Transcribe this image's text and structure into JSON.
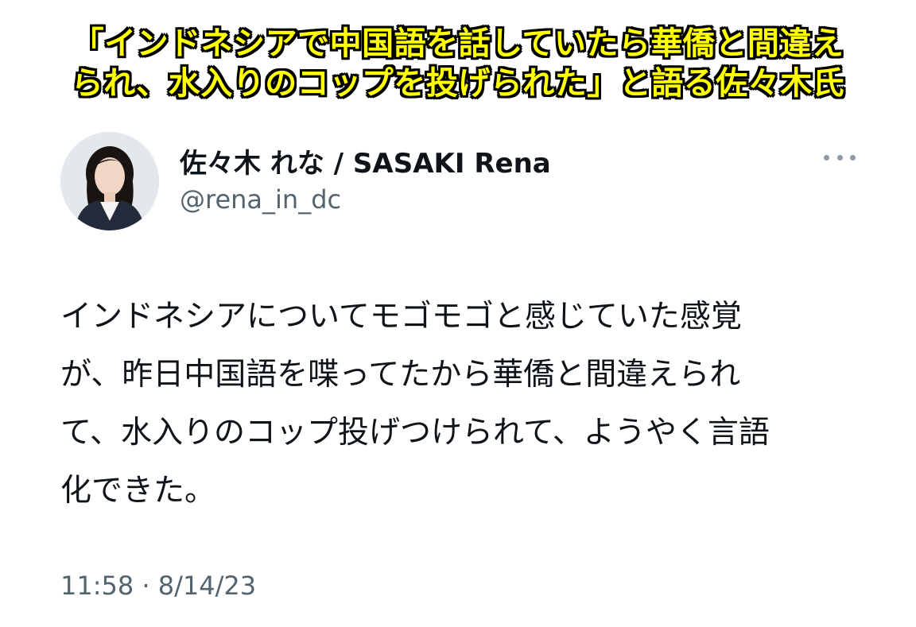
{
  "caption": {
    "line1": "「インドネシアで中国語を話していたら華僑と間違え",
    "line2": "られ、水入りのコップを投げられた」と語る佐々木氏",
    "text_color": "#ffff00",
    "outline_color": "#000000"
  },
  "tweet": {
    "author": {
      "display_name": "佐々木 れな / SASAKI Rena",
      "handle": "@rena_in_dc"
    },
    "more_icon": "more-horizontal-icon",
    "text_lines": [
      "インドネシアについてモゴモゴと感じていた感覚",
      "が、昨日中国語を喋ってたから華僑と間違えられ",
      "て、水入りのコップ投げつけられて、ようやく言語",
      "化できた。"
    ],
    "timestamp": "11:58 · 8/14/23"
  }
}
